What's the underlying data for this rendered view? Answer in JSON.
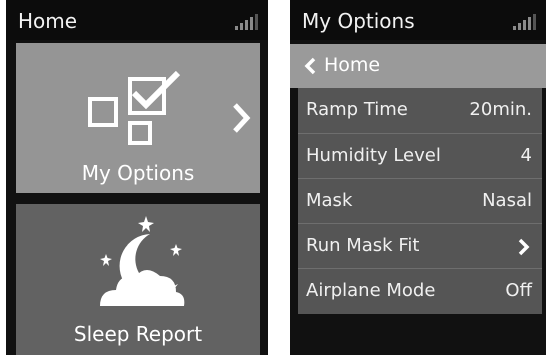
{
  "home": {
    "title": "Home",
    "tiles": [
      {
        "label": "My Options",
        "icon": "checkbox-icon"
      },
      {
        "label": "Sleep Report",
        "icon": "moon-cloud-icon"
      }
    ]
  },
  "options": {
    "title": "My Options",
    "back_label": "Home",
    "items": [
      {
        "label": "Ramp Time",
        "value": "20min."
      },
      {
        "label": "Humidity Level",
        "value": "4"
      },
      {
        "label": "Mask",
        "value": "Nasal"
      },
      {
        "label": "Run Mask Fit",
        "value": ""
      },
      {
        "label": "Airplane Mode",
        "value": "Off"
      }
    ]
  },
  "colors": {
    "screen_bg": "#111111",
    "tile_active": "#959595",
    "tile_inactive": "#626262",
    "list_bg": "#555555"
  }
}
